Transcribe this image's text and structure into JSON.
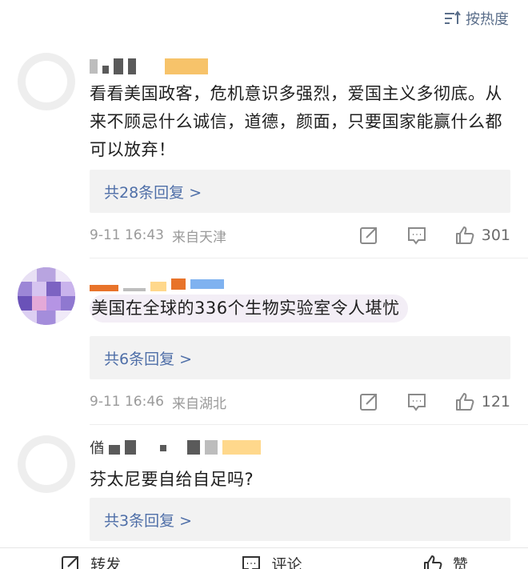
{
  "sort": {
    "label": "按热度"
  },
  "comments": [
    {
      "text": "看看美国政客，危机意识多强烈，爱国主义多彻底。从来不顾忌什么诚信，道德，颜面，只要国家能赢什么都可以放弃！",
      "replies": "共28条回复 >",
      "time": "9-11 16:43",
      "location": "来自天津",
      "likes": "301"
    },
    {
      "text": "美国在全球的336个生物实验室令人堪忧",
      "replies": "共6条回复 >",
      "time": "9-11 16:46",
      "location": "来自湖北",
      "likes": "121"
    },
    {
      "name_prefix": "偤",
      "text": "芬太尼要自给自足吗?",
      "replies": "共3条回复 >"
    }
  ],
  "bottom": {
    "repost": "转发",
    "comment": "评论",
    "like": "赞"
  }
}
